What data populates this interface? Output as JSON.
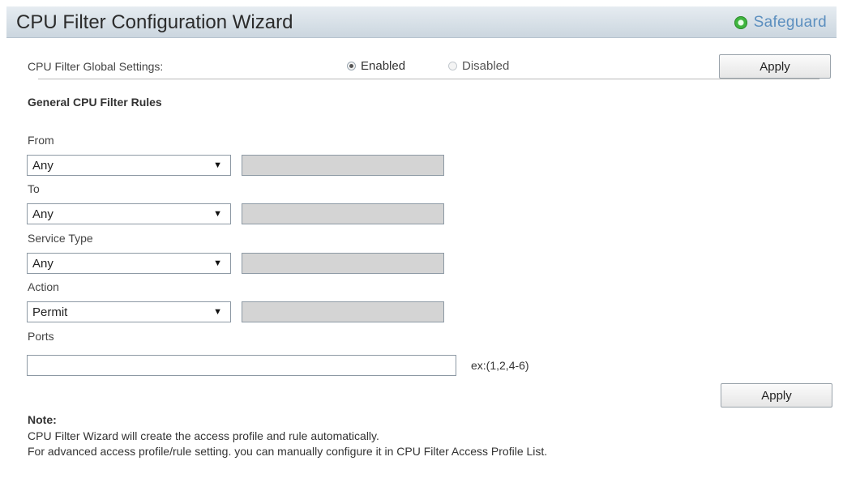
{
  "header": {
    "title": "CPU Filter Configuration Wizard",
    "safeguard_label": "Safeguard",
    "safeguard_color": "#3fb53f"
  },
  "global": {
    "label": "CPU Filter Global Settings:",
    "options": [
      "Enabled",
      "Disabled"
    ],
    "selected": "Enabled",
    "apply_label": "Apply"
  },
  "rules": {
    "section_title": "General CPU Filter Rules",
    "from": {
      "label": "From",
      "selected": "Any",
      "text_value": ""
    },
    "to": {
      "label": "To",
      "selected": "Any",
      "text_value": ""
    },
    "service_type": {
      "label": "Service Type",
      "selected": "Any",
      "text_value": ""
    },
    "action": {
      "label": "Action",
      "selected": "Permit",
      "text_value": ""
    },
    "ports": {
      "label": "Ports",
      "value": "",
      "hint": "ex:(1,2,4-6)"
    },
    "apply_label": "Apply"
  },
  "note": {
    "title": "Note:",
    "lines": [
      "CPU Filter Wizard will create the access profile and rule automatically.",
      "For advanced access profile/rule setting. you can manually configure it in CPU Filter Access Profile List."
    ]
  },
  "icons": {
    "safeguard": "status-led-icon",
    "dropdown": "dropdown-arrow-icon"
  }
}
